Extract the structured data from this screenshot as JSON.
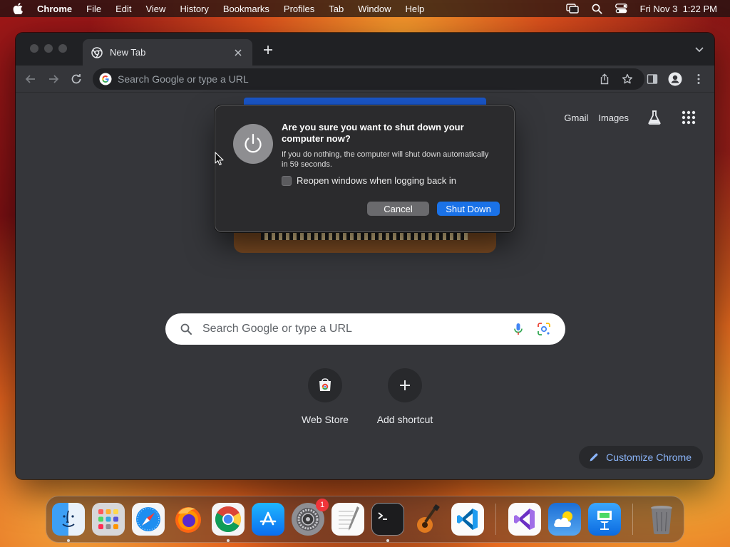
{
  "menubar": {
    "app_name": "Chrome",
    "items": [
      "File",
      "Edit",
      "View",
      "History",
      "Bookmarks",
      "Profiles",
      "Tab",
      "Window",
      "Help"
    ],
    "clock": "Fri Nov 3  1:22 PM"
  },
  "browser": {
    "tab": {
      "title": "New Tab"
    },
    "omnibox": {
      "placeholder": "Search Google or type a URL"
    },
    "links": {
      "gmail": "Gmail",
      "images": "Images"
    },
    "search": {
      "placeholder": "Search Google or type a URL"
    },
    "shortcuts": [
      {
        "label": "Web Store"
      },
      {
        "label": "Add shortcut"
      }
    ],
    "customize": {
      "label": "Customize Chrome"
    },
    "accent_color": "#8ab4f8"
  },
  "dialog": {
    "heading": "Are you sure you want to shut down your computer now?",
    "info": "If you do nothing, the computer will shut down automatically in 59 seconds.",
    "reopen_label": "Reopen windows when logging back in",
    "reopen_checked": false,
    "cancel_label": "Cancel",
    "shutdown_label": "Shut Down",
    "primary_color": "#1a72e8"
  },
  "dock": {
    "apps": [
      "Finder",
      "Launchpad",
      "Safari",
      "Firefox",
      "Google Chrome",
      "App Store",
      "System Settings",
      "TextEdit",
      "Terminal",
      "GarageBand",
      "Visual Studio Code",
      "Visual Studio",
      "Weather",
      "Keynote",
      "Trash"
    ],
    "settings_badge": "1"
  }
}
